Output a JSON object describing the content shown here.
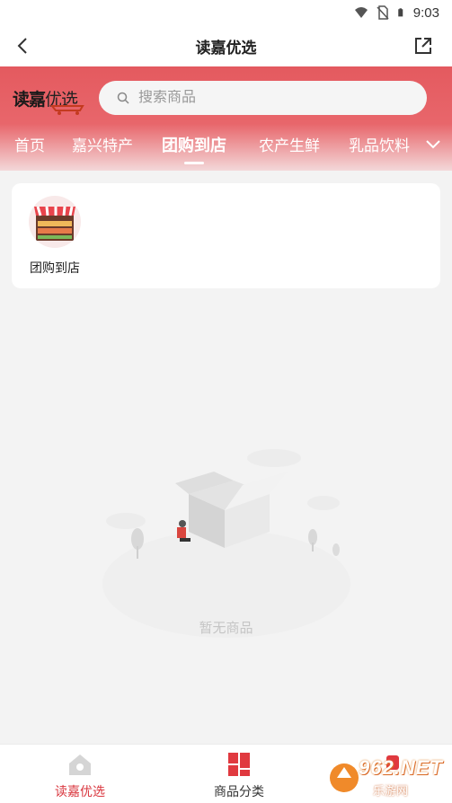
{
  "status_bar": {
    "time": "9:03",
    "icons": [
      "wifi-icon",
      "no-sim-icon",
      "battery-icon"
    ]
  },
  "title_bar": {
    "title": "读嘉优选",
    "back_icon": "chevron-left-icon",
    "share_icon": "share-external-icon"
  },
  "header": {
    "logo_text_main": "读嘉",
    "logo_text_sub": "优选",
    "search_placeholder": "搜索商品",
    "accent_color": "#e45a5f"
  },
  "tabs": [
    {
      "label": "首页",
      "active": false
    },
    {
      "label": "嘉兴特产",
      "active": false
    },
    {
      "label": "团购到店",
      "active": true
    },
    {
      "label": "农产生鲜",
      "active": false
    },
    {
      "label": "乳品饮料",
      "active": false
    }
  ],
  "category_card": {
    "items": [
      {
        "label": "团购到店",
        "icon": "storefront-icon"
      }
    ]
  },
  "empty_state": {
    "message": "暂无商品",
    "illustration": "empty-box-illustration"
  },
  "bottom_nav": {
    "items": [
      {
        "label": "读嘉优选",
        "icon": "home-icon",
        "active": true
      },
      {
        "label": "商品分类",
        "icon": "category-icon",
        "active": false
      },
      {
        "label": "",
        "icon": "cart-icon",
        "active": false
      }
    ],
    "active_color": "#d9363e"
  },
  "watermark": {
    "text": "962.NET",
    "sub": "乐游网"
  }
}
